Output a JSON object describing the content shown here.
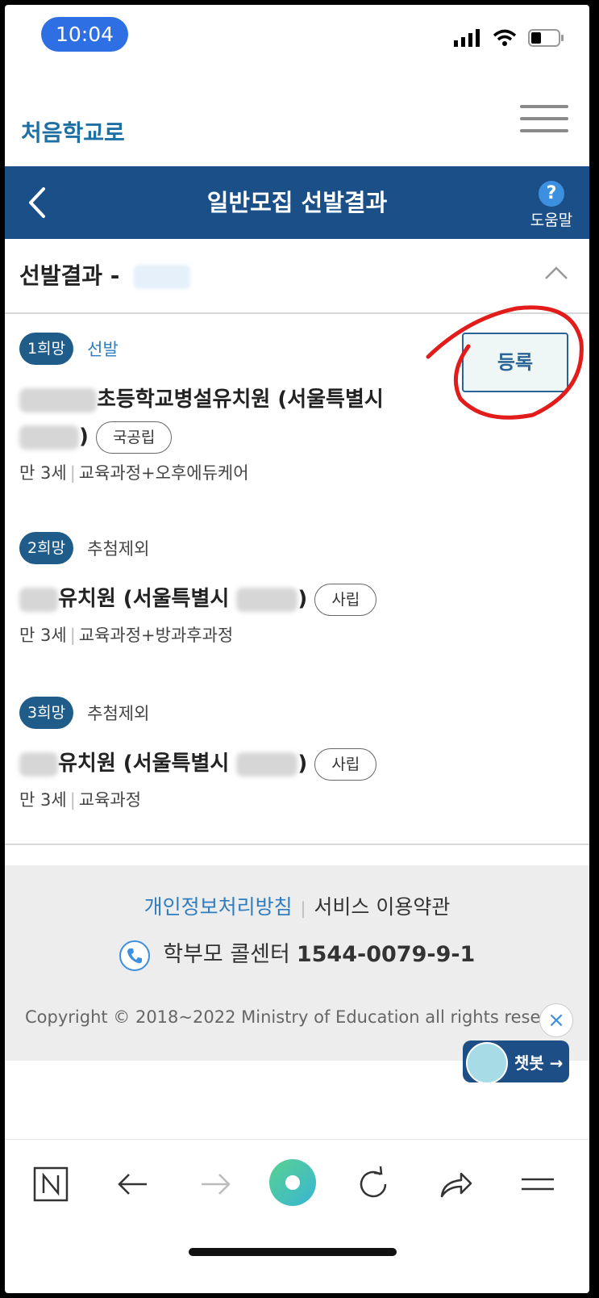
{
  "status_bar": {
    "time": "10:04"
  },
  "app": {
    "logo_text": "처음학교로",
    "brand_color": "#1b4f88"
  },
  "title_bar": {
    "title": "일반모집 선발결과",
    "help_label": "도움말",
    "help_glyph": "?"
  },
  "section": {
    "title": "선발결과 -"
  },
  "entries": [
    {
      "rank": "1희망",
      "status": "선발",
      "name_line1": "초등학교병설유치원 (서울특별시",
      "name_close": ")",
      "type": "국공립",
      "age": "만 3세",
      "course": "교육과정+오후에듀케어",
      "action": "등록"
    },
    {
      "rank": "2희망",
      "status": "추첨제외",
      "name": "유치원 (서울특별시",
      "name_close": ")",
      "type": "사립",
      "age": "만 3세",
      "course": "교육과정+방과후과정"
    },
    {
      "rank": "3희망",
      "status": "추첨제외",
      "name": "유치원 (서울특별시",
      "name_close": ")",
      "type": "사립",
      "age": "만 3세",
      "course": "교육과정"
    }
  ],
  "footer": {
    "privacy": "개인정보처리방침",
    "terms": "서비스 이용약관",
    "call_center_label": "학부모 콜센터",
    "call_center_number": "1544-0079-9-1",
    "copyright": "Copyright © 2018~2022 Ministry of Education all rights reserve"
  },
  "chatbot": {
    "label": "챗봇 →",
    "close": "×"
  },
  "icons": {
    "menu": "hamburger-icon",
    "back": "chevron-left-icon",
    "collapse": "chevron-up-icon",
    "browser": [
      "n-icon",
      "arrow-left-icon",
      "arrow-right-icon",
      "home-circle-icon",
      "refresh-icon",
      "share-icon",
      "menu-icon"
    ]
  }
}
